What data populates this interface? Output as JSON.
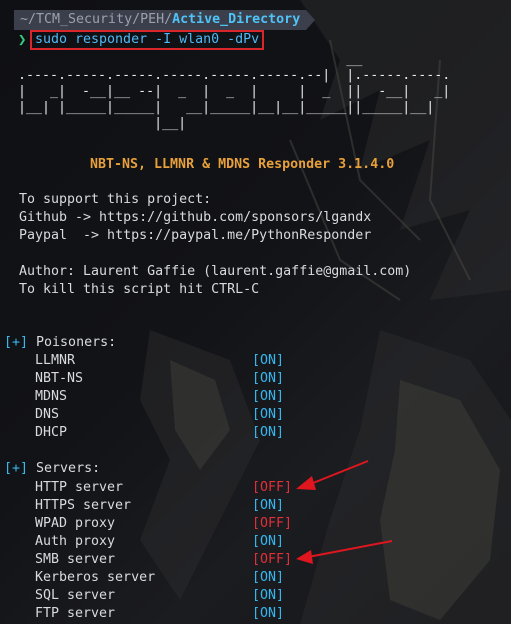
{
  "prompt": {
    "path_prefix": "~/TCM_Security/PEH/",
    "path_tail": "Active_Directory",
    "prompt_char": "❯",
    "command": "sudo responder -I wlan0 -dPv"
  },
  "banner": {
    "ascii_art": "                                         __\n.----.-----.-----.-----.-----.-----.--|  |.-----.----.\n|   _|  -__|__ --|  _  |  _  |     |  _  ||  -__|   _|\n|__| |_____|_____|   __|_____|__|__|_____||_____|__|\n                 |__|",
    "title": "NBT-NS, LLMNR & MDNS Responder 3.1.4.0"
  },
  "info": {
    "support_line": "To support this project:",
    "github": "Github -> https://github.com/sponsors/lgandx",
    "paypal": "Paypal  -> https://paypal.me/PythonResponder",
    "author": "Author: Laurent Gaffie (laurent.gaffie@gmail.com)",
    "kill": "To kill this script hit CTRL-C"
  },
  "poisoners": {
    "tag": "[+]",
    "label": " Poisoners:",
    "items": [
      {
        "name": "LLMNR",
        "status": "[ON]",
        "state": "on"
      },
      {
        "name": "NBT-NS",
        "status": "[ON]",
        "state": "on"
      },
      {
        "name": "MDNS",
        "status": "[ON]",
        "state": "on"
      },
      {
        "name": "DNS",
        "status": "[ON]",
        "state": "on"
      },
      {
        "name": "DHCP",
        "status": "[ON]",
        "state": "on"
      }
    ]
  },
  "servers": {
    "tag": "[+]",
    "label": " Servers:",
    "items": [
      {
        "name": "HTTP server",
        "status": "[OFF]",
        "state": "off"
      },
      {
        "name": "HTTPS server",
        "status": "[ON]",
        "state": "on"
      },
      {
        "name": "WPAD proxy",
        "status": "[OFF]",
        "state": "off"
      },
      {
        "name": "Auth proxy",
        "status": "[ON]",
        "state": "on"
      },
      {
        "name": "SMB server",
        "status": "[OFF]",
        "state": "off"
      },
      {
        "name": "Kerberos server",
        "status": "[ON]",
        "state": "on"
      },
      {
        "name": "SQL server",
        "status": "[ON]",
        "state": "on"
      },
      {
        "name": "FTP server",
        "status": "[ON]",
        "state": "on"
      }
    ]
  },
  "colors": {
    "on": "#35b7f0",
    "off": "#e0303a",
    "title": "#e8a03a",
    "prompt_green": "#35d07f",
    "annotation_red": "#e0161f"
  }
}
